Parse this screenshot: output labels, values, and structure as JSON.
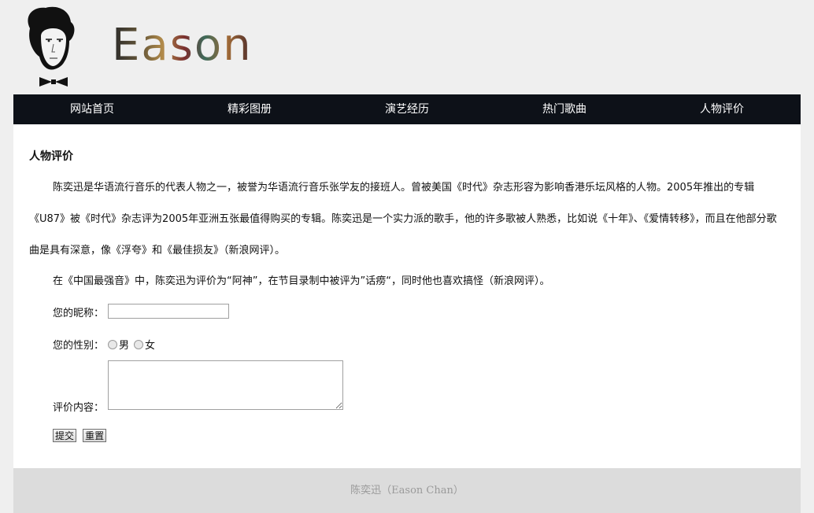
{
  "header": {
    "logo_text": "Eason"
  },
  "nav": {
    "items": [
      {
        "label": "网站首页"
      },
      {
        "label": "精彩图册"
      },
      {
        "label": "演艺经历"
      },
      {
        "label": "热门歌曲"
      },
      {
        "label": "人物评价"
      }
    ]
  },
  "main": {
    "title": "人物评价",
    "paragraph1": "陈奕迅是华语流行音乐的代表人物之一，被誉为华语流行音乐张学友的接班人。曾被美国《时代》杂志形容为影响香港乐坛风格的人物。2005年推出的专辑《U87》被《时代》杂志评为2005年亚洲五张最值得购买的专辑。陈奕迅是一个实力派的歌手，他的许多歌被人熟悉，比如说《十年》、《爱情转移》，而且在他部分歌曲是具有深意，像《浮夸》和《最佳损友》（新浪网评）。",
    "paragraph2": "在《中国最强音》中，陈奕迅为评价为“阿神”，在节目录制中被评为”话痨“，同时他也喜欢搞怪（新浪网评）。",
    "form": {
      "nickname_label": "您的昵称：",
      "nickname_value": "",
      "gender_label": "您的性别：",
      "gender_options": [
        "男",
        "女"
      ],
      "content_label": "评价内容：",
      "content_value": "",
      "submit_label": "提交",
      "reset_label": "重置"
    }
  },
  "footer": {
    "text": "陈奕迅（Eason Chan）"
  }
}
